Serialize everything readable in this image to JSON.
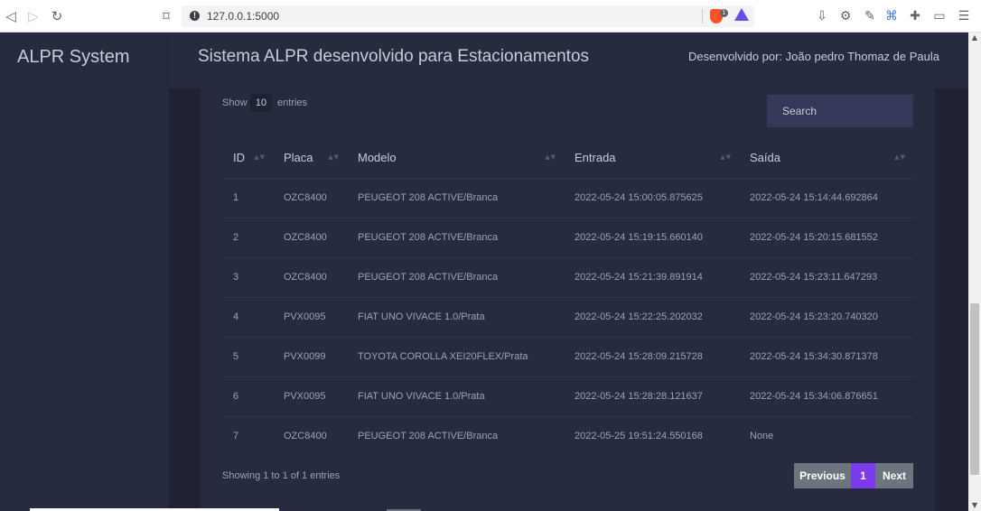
{
  "browser": {
    "url": "127.0.0.1:5000",
    "info_glyph": "!",
    "brave_badge": "1"
  },
  "header": {
    "brand": "ALPR System",
    "title": "Sistema ALPR desenvolvido para Estacionamentos",
    "developer": "Desenvolvido por: João pedro Thomaz de Paula"
  },
  "table_controls": {
    "show_label": "Show",
    "entries_value": "10",
    "entries_label": "entries",
    "search_placeholder": "Search"
  },
  "table": {
    "columns": [
      "ID",
      "Placa",
      "Modelo",
      "Entrada",
      "Saída"
    ],
    "rows": [
      [
        "1",
        "OZC8400",
        "PEUGEOT 208 ACTIVE/Branca",
        "2022-05-24 15:00:05.875625",
        "2022-05-24 15:14:44.692864"
      ],
      [
        "2",
        "OZC8400",
        "PEUGEOT 208 ACTIVE/Branca",
        "2022-05-24 15:19:15.660140",
        "2022-05-24 15:20:15.681552"
      ],
      [
        "3",
        "OZC8400",
        "PEUGEOT 208 ACTIVE/Branca",
        "2022-05-24 15:21:39.891914",
        "2022-05-24 15:23:11.647293"
      ],
      [
        "4",
        "PVX0095",
        "FIAT UNO VIVACE 1.0/Prata",
        "2022-05-24 15:22:25.202032",
        "2022-05-24 15:23:20.740320"
      ],
      [
        "5",
        "PVX0099",
        "TOYOTA COROLLA XEI20FLEX/Prata",
        "2022-05-24 15:28:09.215728",
        "2022-05-24 15:34:30.871378"
      ],
      [
        "6",
        "PVX0095",
        "FIAT UNO VIVACE 1.0/Prata",
        "2022-05-24 15:28:28.121637",
        "2022-05-24 15:34:06.876651"
      ],
      [
        "7",
        "OZC8400",
        "PEUGEOT 208 ACTIVE/Branca",
        "2022-05-25 19:51:24.550168",
        "None"
      ]
    ]
  },
  "footer": {
    "showing": "Showing 1 to 1 of 1 entries",
    "previous": "Previous",
    "page": "1",
    "next": "Next"
  },
  "colors": {
    "background": "#1e2233",
    "panel": "#272b3f",
    "accent": "#7c3aed",
    "pager_button": "#6c757d"
  },
  "icons": [
    "back-icon",
    "forward-icon",
    "reload-icon",
    "bookmark-icon",
    "site-info-icon",
    "brave-shield-icon",
    "brave-rewards-icon",
    "download-icon",
    "extension-icon",
    "tools-icon",
    "translate-icon",
    "puzzle-icon",
    "wallet-icon",
    "menu-icon",
    "sort-icon"
  ]
}
